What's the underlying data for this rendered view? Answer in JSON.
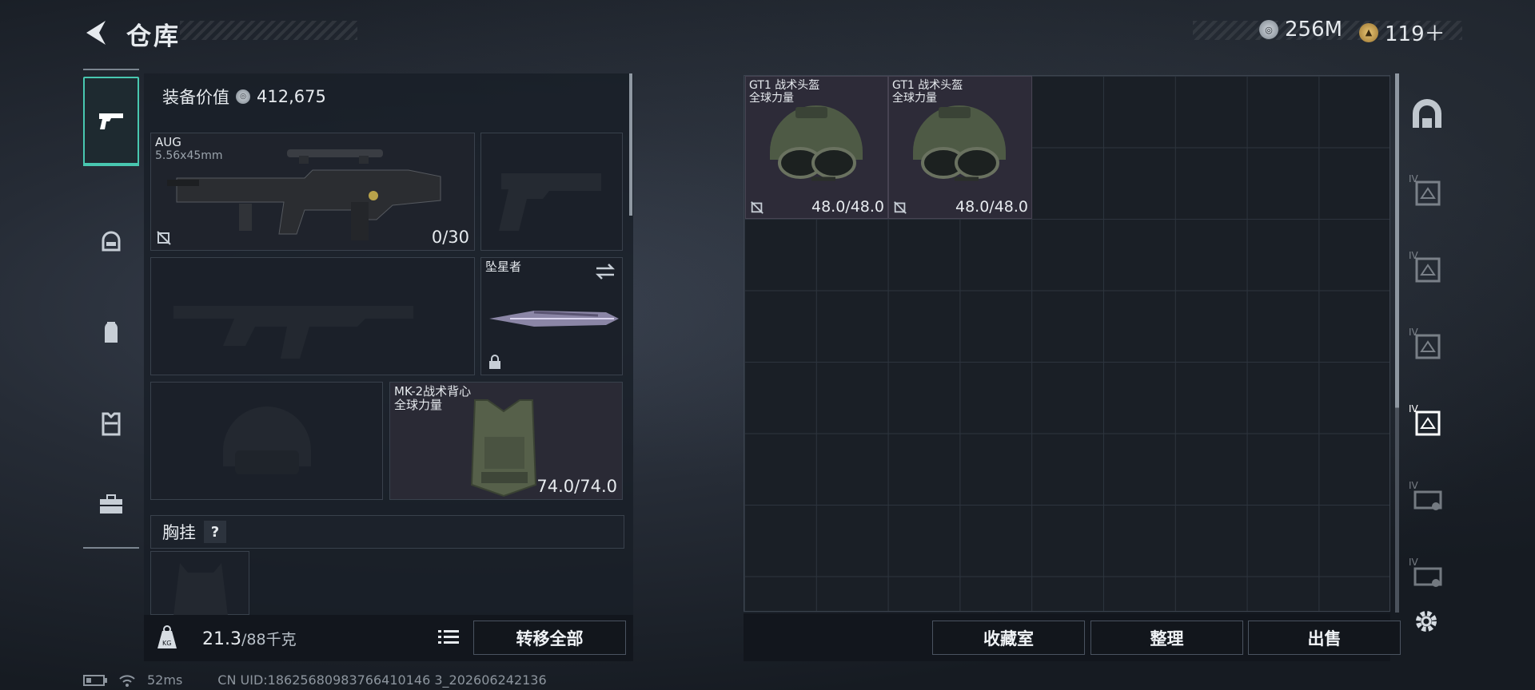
{
  "header": {
    "title": "仓库",
    "currencies": [
      {
        "value": "256M",
        "coin": "silver"
      },
      {
        "value": "119＋",
        "coin": "gold"
      }
    ]
  },
  "left_tabs": [
    {
      "icon": "pistol-icon",
      "active": true
    },
    {
      "icon": "helmet-icon"
    },
    {
      "icon": "backpack-icon"
    },
    {
      "icon": "vest-icon"
    },
    {
      "icon": "briefcase-icon"
    }
  ],
  "equipment": {
    "value_label": "装备价值",
    "value": "412,675",
    "primary": {
      "name": "AUG",
      "caliber": "5.56x45mm",
      "ammo": "0/30"
    },
    "melee": {
      "name": "坠星者"
    },
    "armor": {
      "name": "MK-2战术背心",
      "faction": "全球力量",
      "durability": "74.0/74.0"
    },
    "chest_rig_label": "胸挂",
    "chest_rig_help": "?",
    "weight": {
      "current": "21.3",
      "capacity": "/88千克"
    },
    "transfer_all": "转移全部"
  },
  "storage": {
    "items": [
      {
        "name": "GT1 战术头盔",
        "faction": "全球力量",
        "durability": "48.0/48.0"
      },
      {
        "name": "GT1 战术头盔",
        "faction": "全球力量",
        "durability": "48.0/48.0"
      }
    ],
    "buttons": {
      "collection": "收藏室",
      "organize": "整理",
      "sell": "出售"
    }
  },
  "right_tabs": [
    {
      "icon": "home-vault-icon"
    },
    {
      "icon": "storage-iv-icon",
      "tier": "IV"
    },
    {
      "icon": "storage-iv-icon",
      "tier": "IV"
    },
    {
      "icon": "storage-iv-icon",
      "tier": "IV"
    },
    {
      "icon": "storage-iv-icon",
      "tier": "IV",
      "selected": true
    },
    {
      "icon": "storage-iv-icon",
      "tier": "IV"
    },
    {
      "icon": "storage-iv-icon",
      "tier": "IV"
    }
  ],
  "status": {
    "ping": "52ms",
    "uid": "CN UID:18625680983766410146 3_202606242136"
  }
}
